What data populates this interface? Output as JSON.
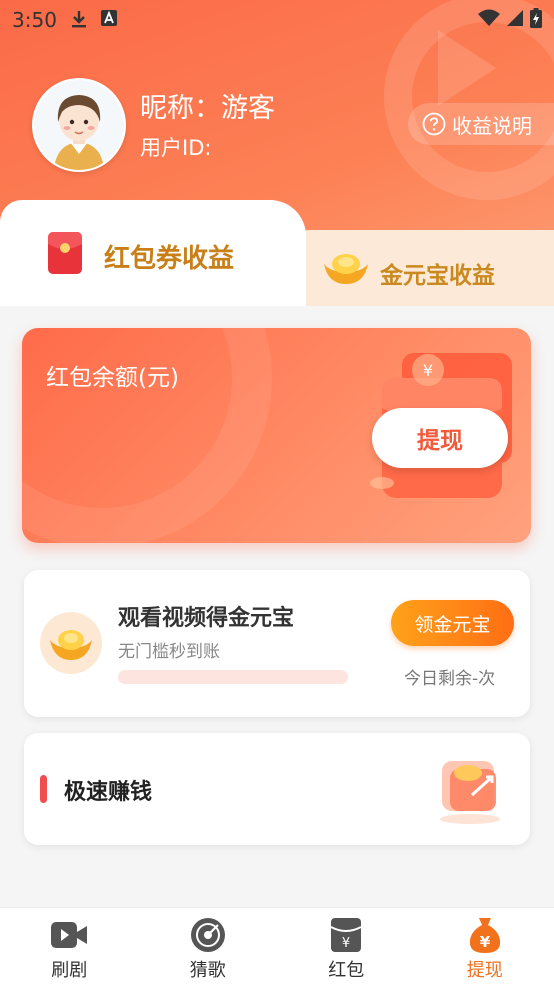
{
  "status_bar": {
    "time": "3:50"
  },
  "profile": {
    "nickname": "昵称：游客",
    "user_id": "用户ID:",
    "income_help": "收益说明"
  },
  "tabs": [
    {
      "label": "红包券收益",
      "active": true
    },
    {
      "label": "金元宝收益",
      "active": false
    }
  ],
  "balance": {
    "label": "红包余额(元)",
    "withdraw_button": "提现"
  },
  "task": {
    "title": "观看视频得金元宝",
    "subtitle": "无门槛秒到账",
    "button": "领金元宝",
    "remaining": "今日剩余-次",
    "progress": 0
  },
  "speed": {
    "title": "极速赚钱"
  },
  "bottom_nav": [
    {
      "label": "刷剧",
      "icon": "video-camera-icon",
      "active": false
    },
    {
      "label": "猜歌",
      "icon": "vinyl-record-icon",
      "active": false
    },
    {
      "label": "红包",
      "icon": "red-envelope-icon",
      "active": false
    },
    {
      "label": "提现",
      "icon": "money-bag-icon",
      "active": true
    }
  ],
  "colors": {
    "brand_orange": "#fb6a48",
    "active_nav": "#f2711c",
    "gold_text": "#c97f18"
  }
}
